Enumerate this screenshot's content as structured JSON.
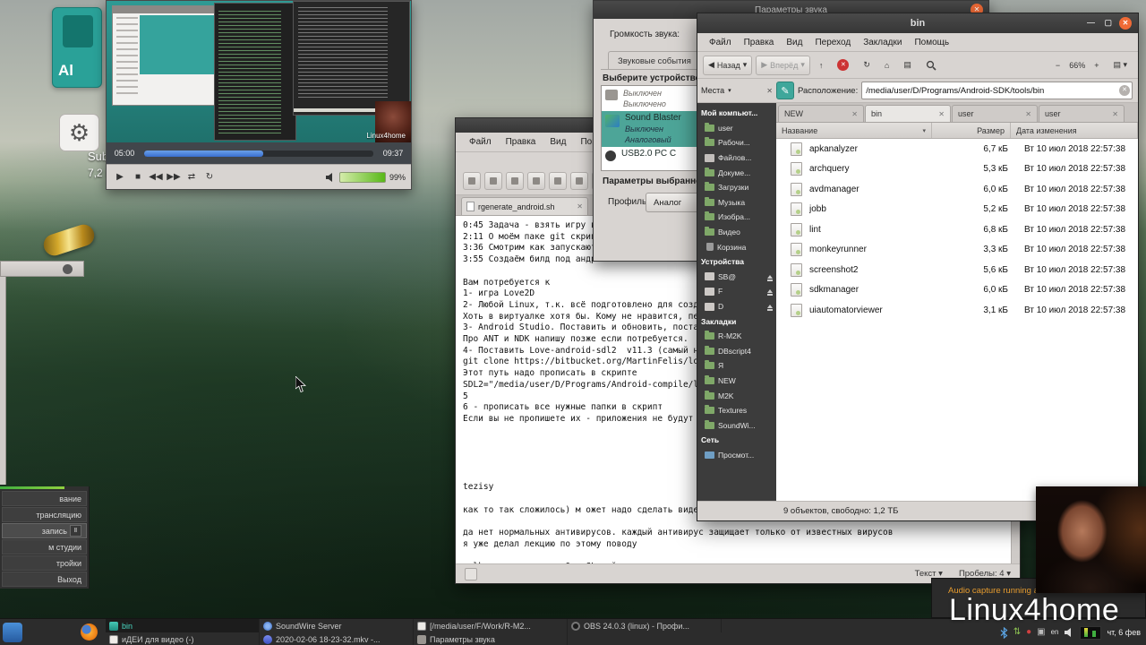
{
  "desktop": {
    "al_label": "Al",
    "sublime_label": "Sublime",
    "sublime_size": "7,2 МБ"
  },
  "player": {
    "current_time": "05:00",
    "total_time": "09:37",
    "progress_percent": 52,
    "volume_percent": "99%",
    "controls": [
      "▶",
      "■",
      "◀◀",
      "▶▶",
      "⇄",
      "↻"
    ],
    "video_watermark": "Linux4home"
  },
  "obs": {
    "buttons": [
      {
        "label": "вание"
      },
      {
        "label": "трансляцию"
      },
      {
        "label": "запись",
        "active": true,
        "pause": "Ⅱ"
      },
      {
        "label": "м студии"
      },
      {
        "label": "тройки"
      },
      {
        "label": "Выход"
      }
    ]
  },
  "editor": {
    "menu": [
      "Файл",
      "Правка",
      "Вид",
      "Поиск"
    ],
    "tab_title": "rgenerate_android.sh",
    "text": "0:45 Задача - взять игру в L\n2:11 О моём паке git скрипто\n3:36 Смотрим как запускаются\n3:55 Создаём билд под андрои\n\nВам потребуется к\n1- игра Love2D\n2- Любой Linux, т.к. всё подготовлено для создания\nХоть в виртуалке хотя бы. Кому не нравится, перепи\n3- Android Studio. Поставить и обновить, поставить\nПро ANT и NDK напишу позже если потребуется.\n4- Поставить Love-android-sdl2  v11.3 (самый новый\ngit clone https://bitbucket.org/MartinFelis/love-a\nЭтот путь надо прописать в скрипте\nSDL2=\"/media/user/D/Programs/Android-compile/love-\n5\n6 - прописать все нужные папки в скрипт\nЕсли вы не пропишете их - приложения не будут попа\n\n\n\n\n\ntezisy\n\nкак то так сложилось) м ожет надо сделать видео и\n\nда нет нормальных антивирусов. каждый антивирус защищает только от известных вирусов\nя уже делал лекцию по этому поводу\n\nvulkan например или OpenGL действительно движок во всех смыслах",
    "status_type": "Текст",
    "status_spaces": "Пробелы: 4"
  },
  "sound": {
    "title": "Параметры звука",
    "volume_label": "Громкость звука:",
    "tab_label": "Звуковые события",
    "choose_heading": "Выберите устройство",
    "devices": [
      {
        "icon": "speaker",
        "name": "",
        "line1": "Выключен",
        "line2": "Выключено"
      },
      {
        "icon": "soundcard",
        "name": "Sound Blaster",
        "line1": "Выключен",
        "line2": "Аналоговый",
        "selected": true
      },
      {
        "icon": "webcam",
        "name": "USB2.0 PC C",
        "line1": "",
        "line2": ""
      }
    ],
    "params_heading": "Параметры выбранного",
    "profile_label": "Профиль:",
    "profile_value": "Аналог"
  },
  "caja": {
    "title": "bin",
    "menu": [
      "Файл",
      "Правка",
      "Вид",
      "Переход",
      "Закладки",
      "Помощь"
    ],
    "toolbar": {
      "back": "Назад",
      "forward": "Вперёд",
      "zoom": "66%"
    },
    "places_label": "Места",
    "location_label": "Расположение:",
    "location_value": "/media/user/D/Programs/Android-SDK/tools/bin",
    "tabs": [
      {
        "label": "NEW"
      },
      {
        "label": "bin",
        "active": true
      },
      {
        "label": "user"
      },
      {
        "label": "user"
      }
    ],
    "columns": {
      "name": "Название",
      "size": "Размер",
      "date": "Дата изменения"
    },
    "files": [
      {
        "name": "apkanalyzer",
        "size": "6,7 кБ",
        "date": "Вт 10 июл 2018 22:57:38"
      },
      {
        "name": "archquery",
        "size": "5,3 кБ",
        "date": "Вт 10 июл 2018 22:57:38"
      },
      {
        "name": "avdmanager",
        "size": "6,0 кБ",
        "date": "Вт 10 июл 2018 22:57:38"
      },
      {
        "name": "jobb",
        "size": "5,2 кБ",
        "date": "Вт 10 июл 2018 22:57:38"
      },
      {
        "name": "lint",
        "size": "6,8 кБ",
        "date": "Вт 10 июл 2018 22:57:38"
      },
      {
        "name": "monkeyrunner",
        "size": "3,3 кБ",
        "date": "Вт 10 июл 2018 22:57:38"
      },
      {
        "name": "screenshot2",
        "size": "5,6 кБ",
        "date": "Вт 10 июл 2018 22:57:38"
      },
      {
        "name": "sdkmanager",
        "size": "6,0 кБ",
        "date": "Вт 10 июл 2018 22:57:38"
      },
      {
        "name": "uiautomatorviewer",
        "size": "3,1 кБ",
        "date": "Вт 10 июл 2018 22:57:38"
      }
    ],
    "sidebar": [
      {
        "label": "Мой компьют...",
        "kind": "header"
      },
      {
        "label": "user",
        "kind": "folder"
      },
      {
        "label": "Рабочи...",
        "kind": "folder"
      },
      {
        "label": "Файлов...",
        "kind": "disk"
      },
      {
        "label": "Докуме...",
        "kind": "folder"
      },
      {
        "label": "Загрузки",
        "kind": "folder"
      },
      {
        "label": "Музыка",
        "kind": "folder"
      },
      {
        "label": "Изобра...",
        "kind": "folder"
      },
      {
        "label": "Видео",
        "kind": "folder"
      },
      {
        "label": "Корзина",
        "kind": "trash"
      },
      {
        "label": "Устройства",
        "kind": "header"
      },
      {
        "label": "SB@",
        "kind": "drive"
      },
      {
        "label": "F",
        "kind": "drive"
      },
      {
        "label": "D",
        "kind": "drive"
      },
      {
        "label": "Закладки",
        "kind": "header"
      },
      {
        "label": "R-M2K",
        "kind": "folder"
      },
      {
        "label": "DBscript4",
        "kind": "folder"
      },
      {
        "label": "Я",
        "kind": "folder"
      },
      {
        "label": "NEW",
        "kind": "folder"
      },
      {
        "label": "M2K",
        "kind": "folder"
      },
      {
        "label": "Textures",
        "kind": "folder"
      },
      {
        "label": "SoundWi...",
        "kind": "folder"
      },
      {
        "label": "Сеть",
        "kind": "header"
      },
      {
        "label": "Просмот...",
        "kind": "network"
      }
    ],
    "status_text": "9 объектов, свободно: 1,2 ТБ"
  },
  "soundwire": {
    "status_text": "Audio capture running at 44.1 kHz"
  },
  "watermark_text": "Linux4home",
  "taskbar": {
    "row1": [
      {
        "label": "bin",
        "icon": "caja",
        "active": true
      },
      {
        "label": "SoundWire Server",
        "icon": "soundwire"
      },
      {
        "label": "[/media/user/F/Work/R-M2...",
        "icon": "document"
      },
      {
        "label": "OBS 24.0.3 (linux) - Профи...",
        "icon": "obs"
      }
    ],
    "row2": [
      {
        "label": "иДЕИ для видео (-)",
        "icon": "pluma"
      },
      {
        "label": "2020-02-06 18-23-32.mkv -...",
        "icon": "video"
      },
      {
        "label": "Параметры звука",
        "icon": "volume"
      }
    ],
    "keyboard_layout": "en",
    "clock": "чт, 6 фев"
  }
}
